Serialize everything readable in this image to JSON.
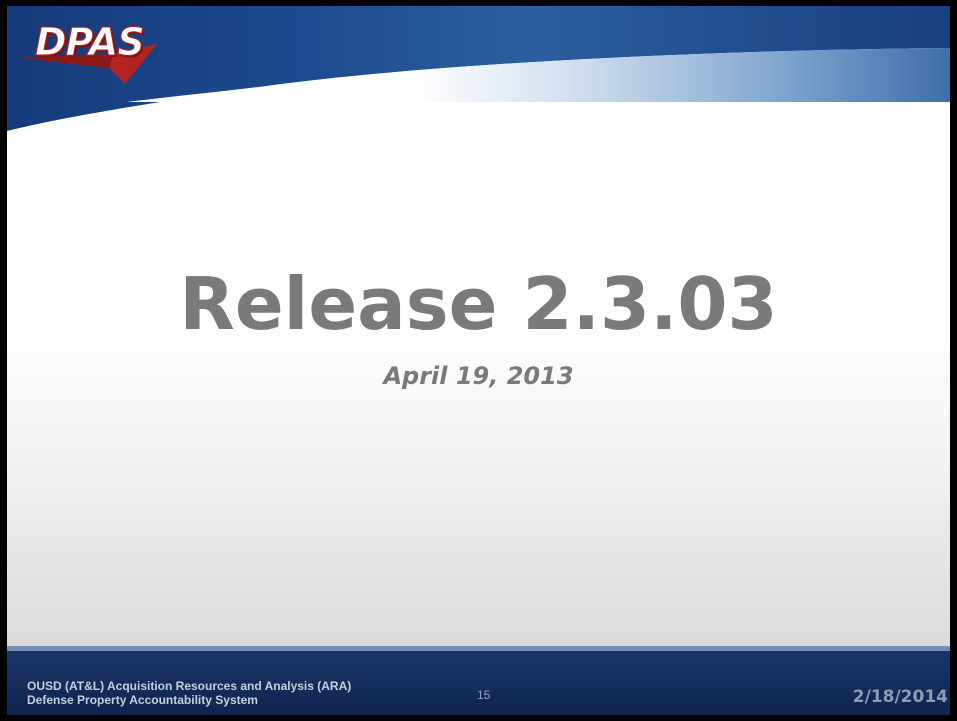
{
  "header": {
    "logo_text": "DPAS"
  },
  "main": {
    "title": "Release 2.3.03",
    "subtitle": "April 19, 2013"
  },
  "footer": {
    "org_line1": "OUSD (AT&L) Acquisition Resources and Analysis (ARA)",
    "org_line2": "Defense Property Accountability System",
    "page_number": "15",
    "date": "2/18/2014"
  },
  "colors": {
    "header_blue": "#1f4a8c",
    "footer_navy": "#0f2550",
    "logo_red": "#b3231f",
    "title_gray": "#7a7a7a"
  }
}
